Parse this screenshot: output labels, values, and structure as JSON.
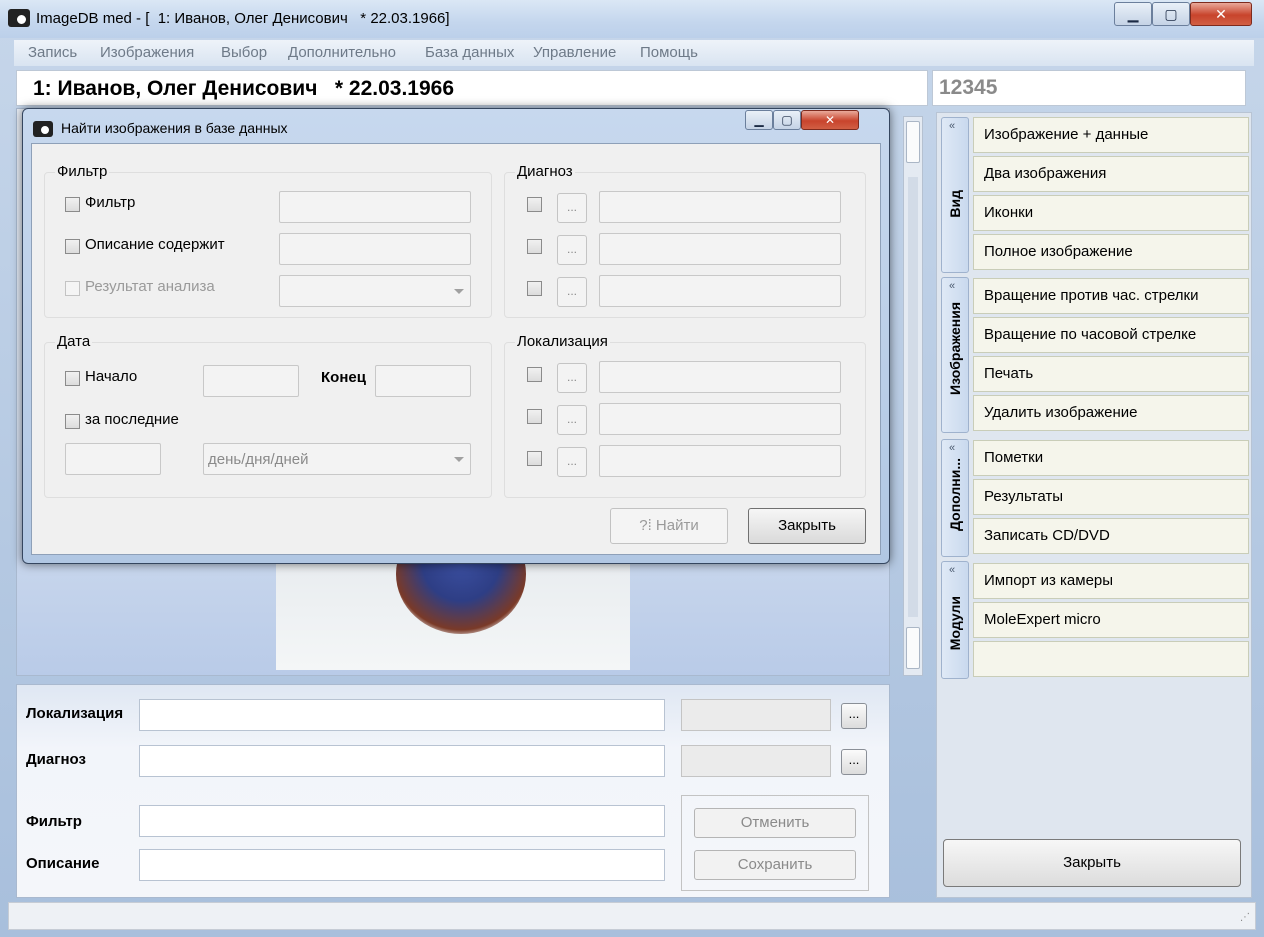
{
  "window": {
    "title": "ImageDB med - [  1: Иванов, Олег Денисович   * 22.03.1966]",
    "min_label": "▁",
    "max_label": "▢",
    "close_label": "✕"
  },
  "menubar": {
    "items": [
      {
        "label": "Запись"
      },
      {
        "label": "Изображения"
      },
      {
        "label": "Выбор"
      },
      {
        "label": "Дополнительно"
      },
      {
        "label": "База данных"
      },
      {
        "label": "Управление"
      },
      {
        "label": "Помощь"
      }
    ]
  },
  "patient": {
    "name": "1: Иванов, Олег Денисович   * 22.03.1966",
    "id": "12345"
  },
  "form": {
    "localization_label": "Локализация",
    "diagnosis_label": "Диагноз",
    "filter_label": "Фильтр",
    "description_label": "Описание",
    "dots_label": "...",
    "cancel_label": "Отменить",
    "save_label": "Сохранить"
  },
  "sidebar": {
    "groups": [
      {
        "tab": "Вид",
        "items": [
          "Изображение + данные",
          "Два изображения",
          "Иконки",
          "Полное изображение"
        ]
      },
      {
        "tab": "Изображения",
        "items": [
          "Вращение против час. стрелки",
          "Вращение по часовой стрелке",
          "Печать",
          "Удалить изображение"
        ]
      },
      {
        "tab": "Дополни...",
        "items": [
          "Пометки",
          "Результаты",
          "Записать CD/DVD"
        ]
      },
      {
        "tab": "Модули",
        "items": [
          "Импорт из камеры",
          "MoleExpert micro",
          ""
        ]
      }
    ],
    "chevron": "«",
    "close_label": "Закрыть"
  },
  "dialog": {
    "title": "Найти изображения в базе данных",
    "filter_group": {
      "title": "Фильтр",
      "filter_label": "Фильтр",
      "description_label": "Описание содержит",
      "analysis_label": "Результат анализа"
    },
    "date_group": {
      "title": "Дата",
      "start_label": "Начало",
      "end_label": "Конец",
      "last_label": "за последние",
      "period_value": "день/дня/дней"
    },
    "diagnosis_group": {
      "title": "Диагноз"
    },
    "localization_group": {
      "title": "Локализация"
    },
    "dots_label": "...",
    "find_label": "?⁞ Найти",
    "close_label": "Закрыть"
  },
  "colors": {
    "window_frame": "#c4d6ed",
    "close_red": "#c8442c",
    "sidebar_item_bg": "#f5f5eb",
    "disabled_text": "#8a8a8a"
  }
}
